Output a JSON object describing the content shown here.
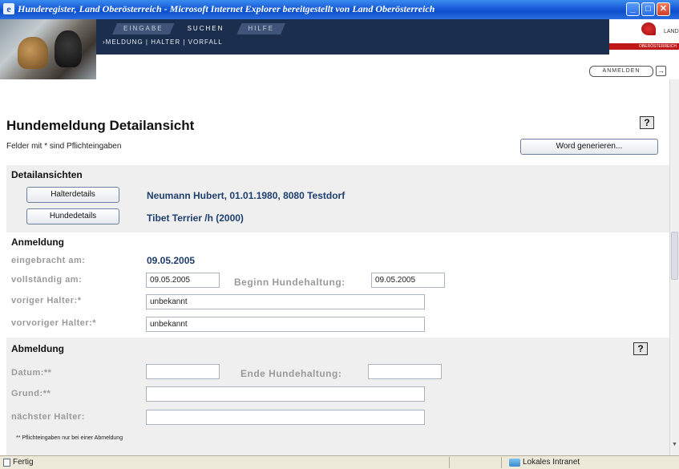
{
  "window": {
    "title": "Hunderegister, Land Oberösterreich - Microsoft Internet Explorer bereitgestellt von Land Oberösterreich",
    "min": "_",
    "max": "□",
    "close": "✕"
  },
  "nav": {
    "tabs": [
      "EINGABE",
      "SUCHEN",
      "HILFE"
    ],
    "active_tab": "SUCHEN",
    "subnav": "›MELDUNG | HALTER | VORFALL"
  },
  "logo": {
    "land": "LAND",
    "bar": "OBERÖSTERREICH"
  },
  "header": {
    "anmelden_label": "ANMELDEN",
    "anmelden_icon": "→"
  },
  "page": {
    "title": "Hundemeldung Detailansicht",
    "required_note": "Felder mit * sind Pflichteingaben",
    "help_label": "?",
    "word_button": "Word generieren..."
  },
  "detail": {
    "title": "Detailansichten",
    "halter_button": "Halterdetails",
    "halter_summary": "Neumann Hubert, 01.01.1980, 8080 Testdorf",
    "hunde_button": "Hundedetails",
    "hunde_summary": "Tibet Terrier /h (2000)"
  },
  "anmeldung": {
    "title": "Anmeldung",
    "eingebracht_label": "eingebracht am:",
    "eingebracht_value": "09.05.2005",
    "vollstaendig_label": "vollständig am:",
    "vollstaendig_value": "09.05.2005",
    "beginn_label": "Beginn Hundehaltung:",
    "beginn_value": "09.05.2005",
    "voriger_label": "voriger Halter:*",
    "voriger_value": "unbekannt",
    "vorvoriger_label": "vorvoriger Halter:*",
    "vorvoriger_value": "unbekannt"
  },
  "abmeldung": {
    "title": "Abmeldung",
    "help_label": "?",
    "datum_label": "Datum:**",
    "datum_value": "",
    "ende_label": "Ende Hundehaltung:",
    "ende_value": "",
    "grund_label": "Grund:**",
    "grund_value": "",
    "naechster_label": "nächster Halter:",
    "naechster_value": "",
    "note": "** Pflichteingaben nur bei einer Abmeldung"
  },
  "status": {
    "left": "Fertig",
    "zone": "Lokales Intranet"
  }
}
